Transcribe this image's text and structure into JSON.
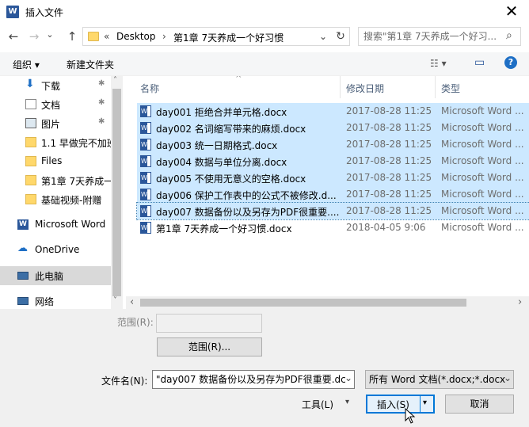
{
  "window": {
    "title": "插入文件",
    "app_icon_letter": "W",
    "close_glyph": "✕"
  },
  "nav": {
    "back": "←",
    "forward": "→",
    "dropdown": "⌄",
    "up": "↑",
    "refresh": "↻"
  },
  "address": {
    "overflow": "«",
    "segments": [
      "Desktop",
      "第1章 7天养成一个好习惯"
    ],
    "separator": "›",
    "dropdown": "⌄"
  },
  "search": {
    "placeholder": "搜索\"第1章 7天养成一个好习...",
    "icon": "⌕"
  },
  "toolbar": {
    "organize": "组织 ▾",
    "new_folder": "新建文件夹",
    "view_icon": "☷ ▾",
    "pane_icon": "▭",
    "help_icon": "?"
  },
  "sidebar": {
    "items": [
      {
        "label": "下载",
        "icon": "download-icon",
        "pinned": true
      },
      {
        "label": "文档",
        "icon": "document-icon",
        "pinned": true
      },
      {
        "label": "图片",
        "icon": "picture-icon",
        "pinned": true
      },
      {
        "label": "1.1 早做完不加班",
        "icon": "folder-icon",
        "pinned": false
      },
      {
        "label": "Files",
        "icon": "folder-icon",
        "pinned": false
      },
      {
        "label": "第1章 7天养成一",
        "icon": "folder-icon",
        "pinned": false
      },
      {
        "label": "基础视频-附赠",
        "icon": "folder-icon",
        "pinned": false
      },
      {
        "label": "Microsoft Word",
        "icon": "word-icon",
        "pinned": false
      },
      {
        "label": "OneDrive",
        "icon": "cloud-icon",
        "pinned": false
      },
      {
        "label": "此电脑",
        "icon": "computer-icon",
        "pinned": false
      },
      {
        "label": "网络",
        "icon": "network-icon",
        "pinned": false
      }
    ],
    "pin_glyph": "✱"
  },
  "columns": {
    "name": "名称",
    "date": "修改日期",
    "type": "类型",
    "sort_glyph": "^"
  },
  "files": [
    {
      "name": "day001 拒绝合并单元格.docx",
      "date": "2017-08-28 11:25",
      "type": "Microsoft Word ...",
      "selected": true
    },
    {
      "name": "day002 名词缩写带来的麻烦.docx",
      "date": "2017-08-28 11:25",
      "type": "Microsoft Word ...",
      "selected": true
    },
    {
      "name": "day003 统一日期格式.docx",
      "date": "2017-08-28 11:25",
      "type": "Microsoft Word ...",
      "selected": true
    },
    {
      "name": "day004 数据与单位分离.docx",
      "date": "2017-08-28 11:25",
      "type": "Microsoft Word ...",
      "selected": true
    },
    {
      "name": "day005 不使用无意义的空格.docx",
      "date": "2017-08-28 11:25",
      "type": "Microsoft Word ...",
      "selected": true
    },
    {
      "name": "day006 保护工作表中的公式不被修改.d...",
      "date": "2017-08-28 11:25",
      "type": "Microsoft Word ...",
      "selected": true
    },
    {
      "name": "day007 数据备份以及另存为PDF很重要....",
      "date": "2017-08-28 11:25",
      "type": "Microsoft Word ...",
      "selected": true
    },
    {
      "name": "第1章 7天养成一个好习惯.docx",
      "date": "2018-04-05 9:06",
      "type": "Microsoft Word ...",
      "selected": false
    }
  ],
  "scroll": {
    "left": "‹",
    "right": "›",
    "up": "˄",
    "down": "˅"
  },
  "range": {
    "label": "范围(R):",
    "value": "",
    "button": "范围(R)..."
  },
  "filename": {
    "label": "文件名(N):",
    "value": "\"day007 数据备份以及另存为PDF很重要.dc",
    "dropdown": "⌄"
  },
  "filetype": {
    "value": "所有 Word 文档(*.docx;*.docx",
    "dropdown": "⌄"
  },
  "actions": {
    "tools": "工具(L)",
    "tools_arrow": "▾",
    "insert": "插入(S)",
    "insert_arrow": "▾",
    "cancel": "取消"
  },
  "colors": {
    "selection": "#cce8ff",
    "accent": "#0078d7",
    "word_blue": "#2b579a"
  }
}
